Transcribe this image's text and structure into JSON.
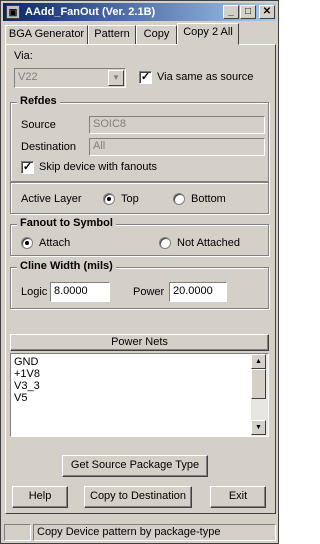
{
  "window": {
    "title": "AAdd_FanOut (Ver. 2.1B)",
    "icon": "app-icon",
    "minimize_glyph": "_",
    "maximize_glyph": "□",
    "close_glyph": "✕"
  },
  "tabs": [
    {
      "label": "BGA Generator"
    },
    {
      "label": "Pattern"
    },
    {
      "label": "Copy"
    },
    {
      "label": "Copy 2 All",
      "active": true
    }
  ],
  "via": {
    "label": "Via:",
    "value": "V22",
    "same_as_source_label": "Via same as source",
    "same_as_source_checked": true
  },
  "refdes": {
    "title": "Refdes",
    "source_label": "Source",
    "source_value": "SOIC8",
    "destination_label": "Destination",
    "destination_value": "All",
    "skip_label": "Skip device with fanouts",
    "skip_checked": true
  },
  "active_layer": {
    "label": "Active Layer",
    "options": [
      {
        "label": "Top",
        "selected": true
      },
      {
        "label": "Bottom",
        "selected": false
      }
    ]
  },
  "fanout_to_symbol": {
    "title": "Fanout to Symbol",
    "options": [
      {
        "label": "Attach",
        "selected": true
      },
      {
        "label": "Not Attached",
        "selected": false
      }
    ]
  },
  "cline_width": {
    "title": "Cline Width (mils)",
    "logic_label": "Logic",
    "logic_value": "8.0000",
    "power_label": "Power",
    "power_value": "20.0000"
  },
  "power_nets": {
    "button_label": "Power Nets",
    "items": [
      "GND",
      "+1V8",
      "V3_3",
      "V5"
    ]
  },
  "buttons": {
    "get_source": "Get Source Package Type",
    "help": "Help",
    "copy_to_destination": "Copy to Destination",
    "exit": "Exit"
  },
  "statusbar": {
    "text": "Copy Device pattern by package-type"
  }
}
